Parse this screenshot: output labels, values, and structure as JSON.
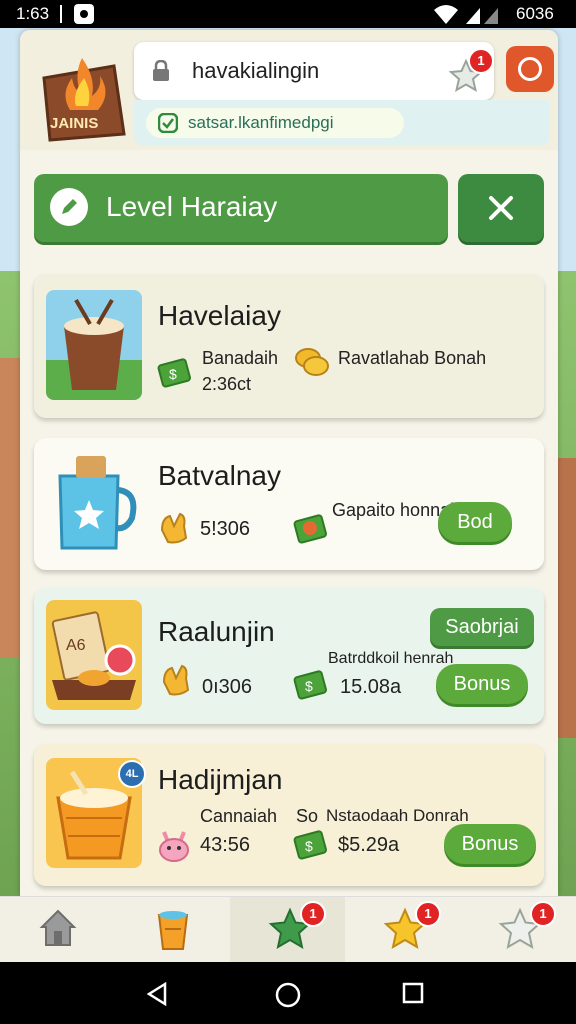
{
  "status_bar": {
    "time": "1:63",
    "battery_text": "6036"
  },
  "header": {
    "logo_text": "JAINIS",
    "url": "havakialingin",
    "sub_text": "satsar.lkanfimedpgi",
    "notification_count": "1"
  },
  "level_bar": {
    "title": "Level Haraiay"
  },
  "cards": [
    {
      "title": "Havelaiay",
      "left_label": "Banadaih",
      "left_value": "2:36ct",
      "right_label": "Ravatlahab Bonah"
    },
    {
      "title": "Batvalnay",
      "left_value": "5!306",
      "right_label": "Gapaito honnah",
      "button": "Bod"
    },
    {
      "title": "Raalunjin",
      "tag": "Saobrjai",
      "left_value": "0ı306",
      "right_label": "Batrddkoil henrah",
      "right_value": "15.08a",
      "button": "Bonus"
    },
    {
      "title": "Hadijmjan",
      "badge": "4L",
      "left_label": "Cannaiah",
      "left_value": "43:56",
      "middle_label": "So",
      "right_label": "Nstaodaah Donrah",
      "right_value": "$5.29a",
      "button": "Bonus"
    }
  ],
  "bottom_nav": {
    "items": [
      {
        "icon": "home-icon"
      },
      {
        "icon": "cup-icon"
      },
      {
        "icon": "green-star-icon",
        "badge": "1"
      },
      {
        "icon": "gold-star-icon",
        "badge": "1"
      },
      {
        "icon": "white-star-icon",
        "badge": "1"
      }
    ]
  },
  "colors": {
    "primary_green": "#4f9b45",
    "accent_orange": "#e0572c",
    "badge_red": "#e02323"
  }
}
